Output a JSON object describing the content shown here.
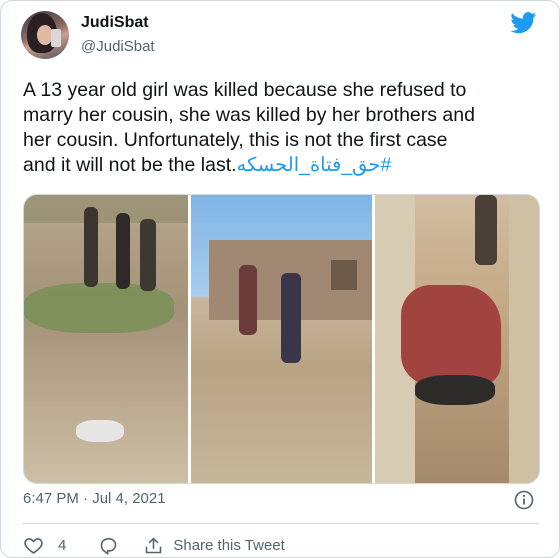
{
  "user": {
    "display_name": "JudiSbat",
    "handle": "@JudiSbat"
  },
  "tweet": {
    "lines": [
      "A 13 year old girl was killed because she refused to",
      "marry her cousin, she was killed by her brothers and",
      "her cousin. Unfortunately, this is not the first case"
    ],
    "last_line": "and it will not be the last.",
    "hashtag": "#حق_فتاة_الحسكه"
  },
  "timestamp": "6:47 PM · Jul 4, 2021",
  "actions": {
    "like_count": "4",
    "share_label": "Share this Tweet"
  },
  "icons": [
    "twitter-bird-icon",
    "info-icon",
    "heart-icon",
    "reply-icon",
    "share-icon"
  ],
  "colors": {
    "brand": "#1d9bf0",
    "text": "#0f1419",
    "secondary": "#536471",
    "border": "#cfd9de"
  }
}
